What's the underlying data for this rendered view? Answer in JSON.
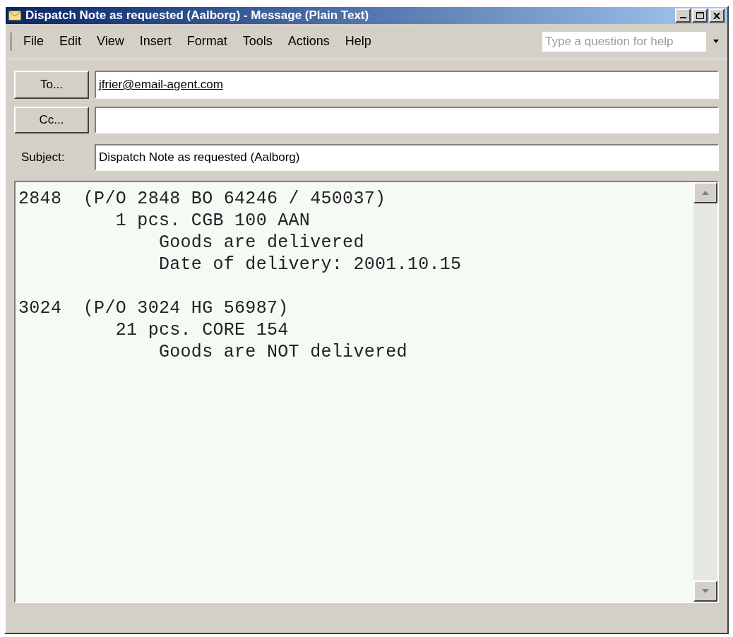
{
  "window": {
    "title": "Dispatch Note as requested (Aalborg) - Message (Plain Text)"
  },
  "menu": [
    "File",
    "Edit",
    "View",
    "Insert",
    "Format",
    "Tools",
    "Actions",
    "Help"
  ],
  "help_box": {
    "placeholder": "Type a question for help"
  },
  "to": {
    "button": "To...",
    "value": "jfrier@email-agent.com"
  },
  "cc": {
    "button": "Cc..."
  },
  "subject": {
    "label": "Subject:",
    "value": "Dispatch Note as requested (Aalborg)"
  },
  "body": [
    [
      "2848  (P/O 2848 BO 64246 / 450037)",
      "         1 pcs. CGB 100 AAN",
      "             Goods are delivered",
      "             Date of delivery: 2001.10.15"
    ],
    [
      "3024  (P/O 3024 HG 56987)",
      "         21 pcs. CORE 154",
      "             Goods are NOT delivered"
    ]
  ]
}
